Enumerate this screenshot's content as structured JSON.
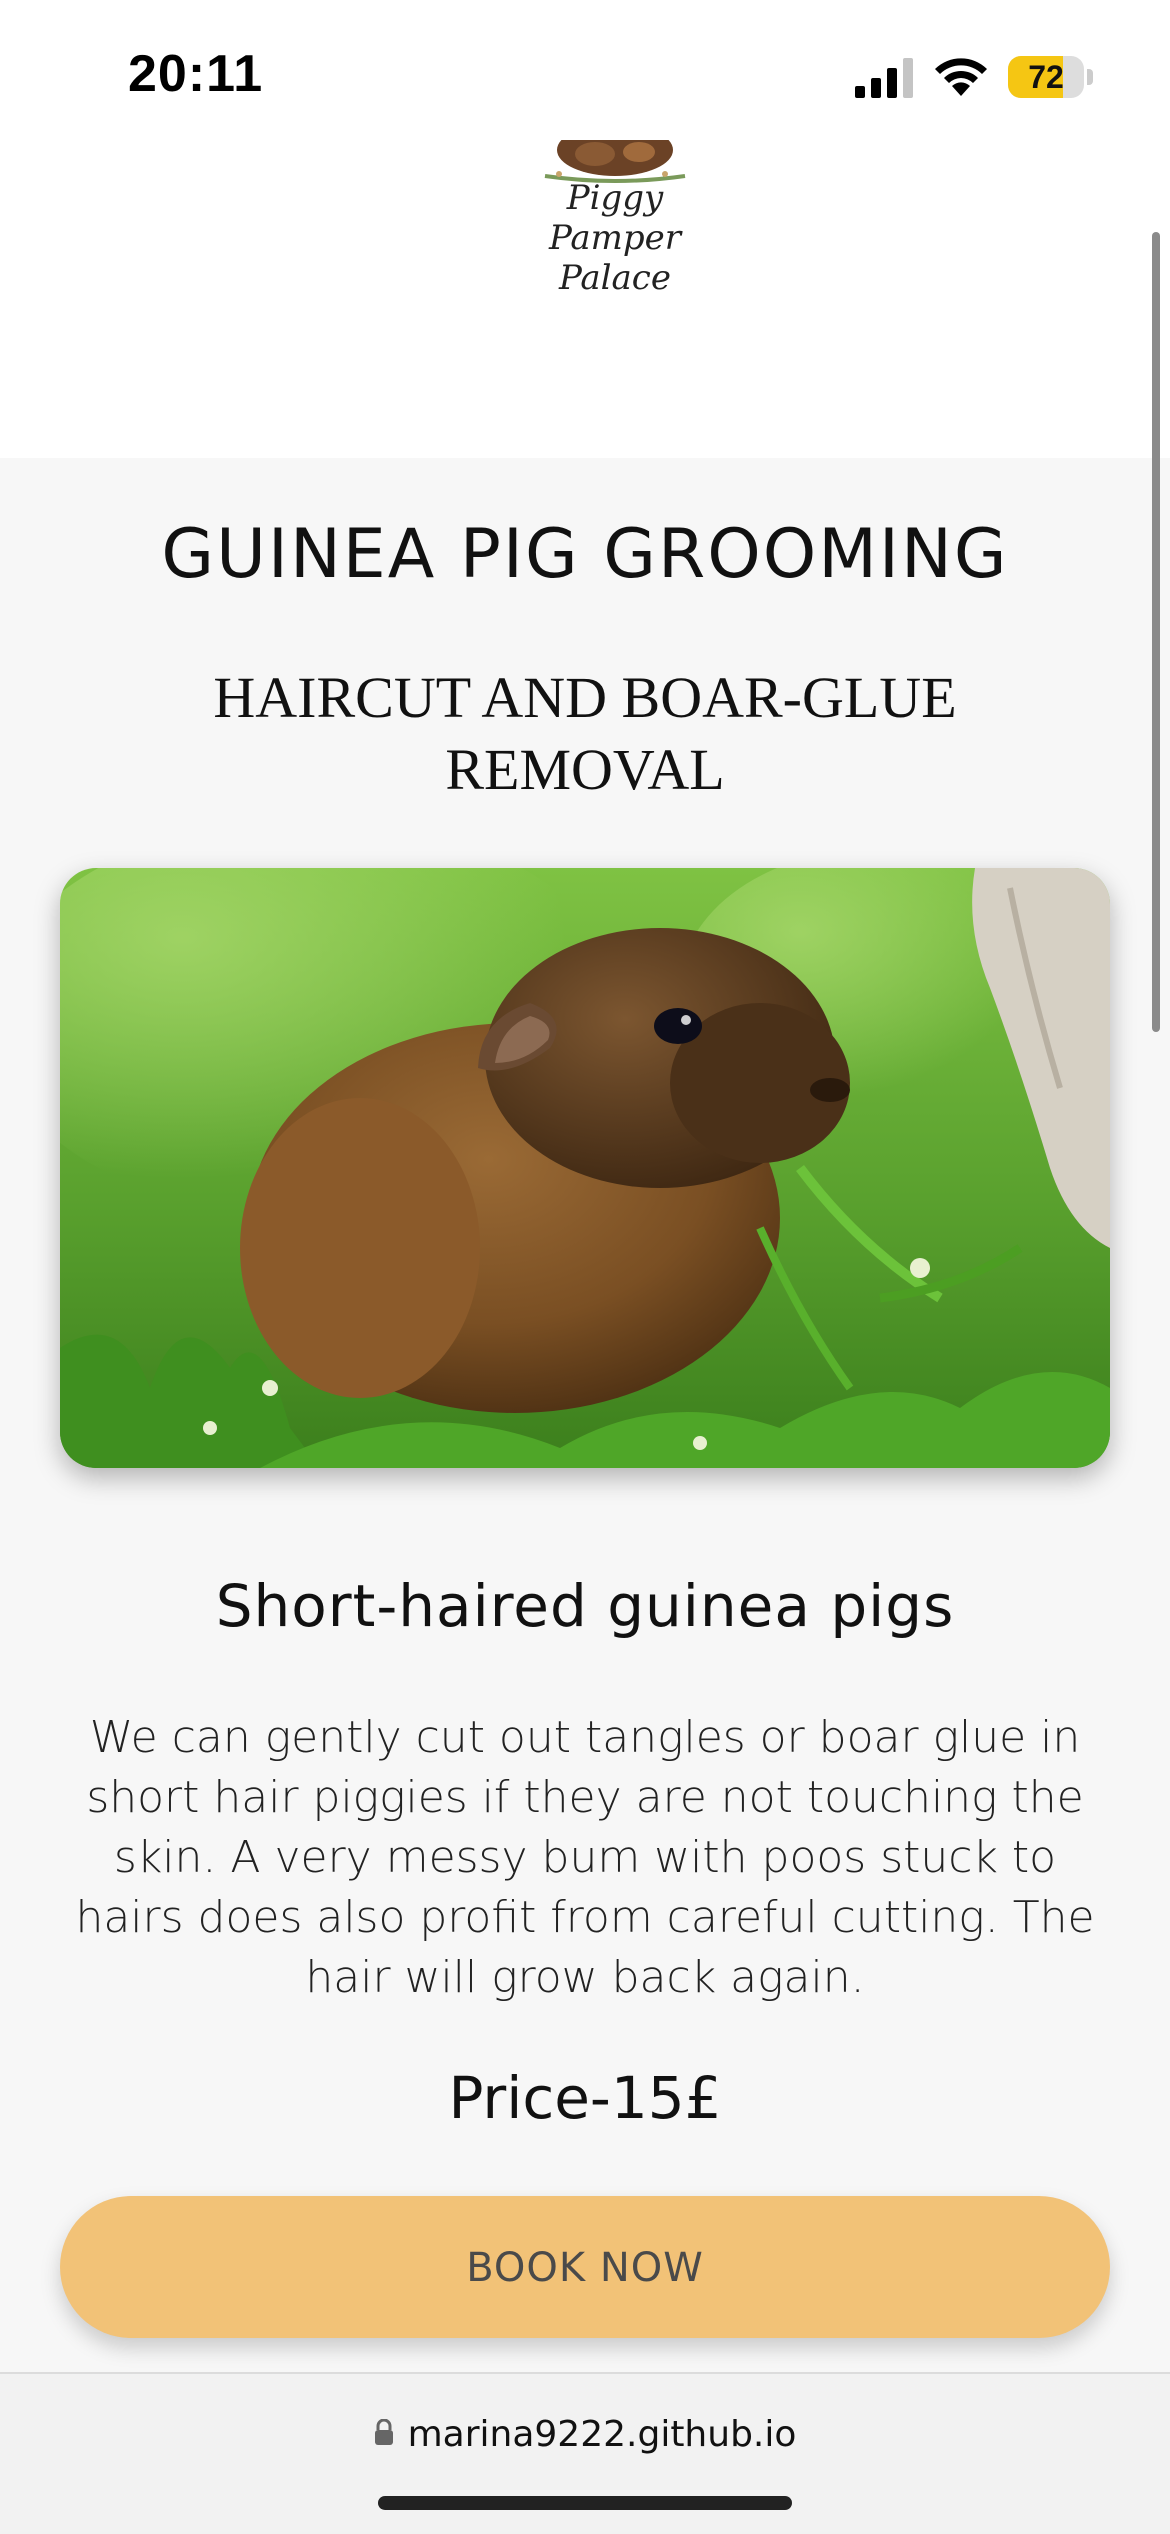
{
  "status_bar": {
    "time": "20:11",
    "battery_percent": "72",
    "battery_level": 0.72,
    "signal_bars": 3,
    "signal_icon": "cellular-signal-icon",
    "wifi_icon": "wifi-icon",
    "battery_color": "#f5c613"
  },
  "header": {
    "logo_text": "Piggy Pamper Palace"
  },
  "main": {
    "title": "GUINEA PIG GROOMING",
    "subtitle": "HAIRCUT AND BOAR-GLUE REMOVAL",
    "hero_image": "guinea-pig-in-grass-photo",
    "section_heading": "Short-haired guinea pigs",
    "description": "We can gently cut out tangles or boar glue in short hair piggies if they are not touching the skin. A very messy bum with poos stuck to hairs does also profit from careful cutting. The hair will grow back again.",
    "price": "Price-15£",
    "book_button": "BOOK NOW",
    "button_color": "#f2c277"
  },
  "browser": {
    "url": "marina9222.github.io",
    "lock_icon": "lock-icon"
  }
}
